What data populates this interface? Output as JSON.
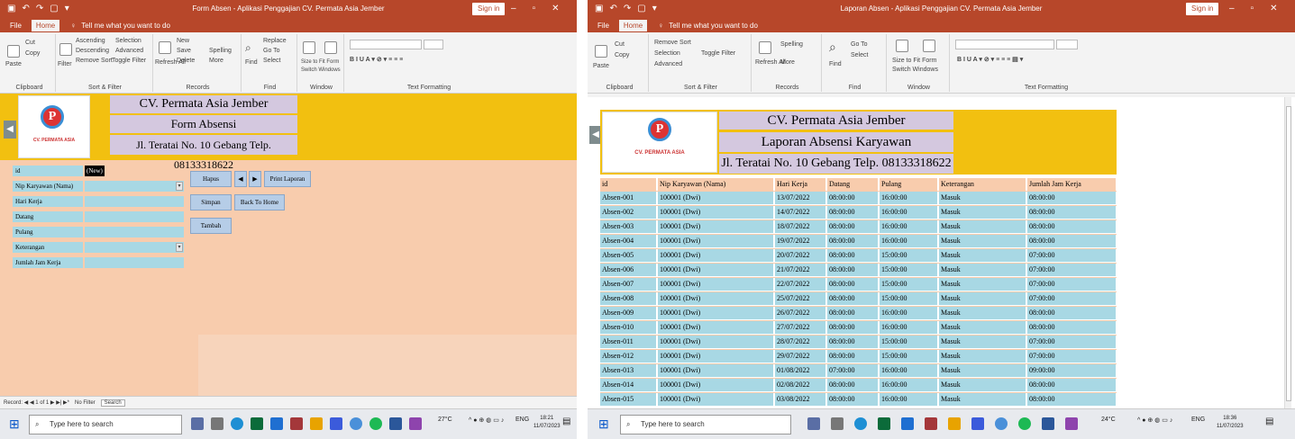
{
  "form_window": {
    "title": "Form Absen - Aplikasi Penggajian CV. Permata Asia Jember",
    "sign_in": "Sign in",
    "tabs": [
      "File",
      "Home"
    ],
    "tell_me": "Tell me what you want to do",
    "ribbon": {
      "clipboard": {
        "label": "Clipboard",
        "items": [
          "Cut",
          "Copy",
          "Paste"
        ]
      },
      "sort_filter": {
        "label": "Sort & Filter",
        "items": [
          "Ascending",
          "Descending",
          "Remove Sort",
          "Selection",
          "Advanced",
          "Toggle Filter",
          "Filter"
        ]
      },
      "records": {
        "label": "Records",
        "items": [
          "New",
          "Save",
          "Delete",
          "Refresh All",
          "Spelling",
          "More"
        ]
      },
      "find": {
        "label": "Find",
        "items": [
          "Replace",
          "Go To",
          "Select",
          "Find"
        ]
      },
      "window": {
        "label": "Window",
        "items": [
          "Size to Fit Form",
          "Switch Windows"
        ]
      },
      "text_formatting": {
        "label": "Text Formatting"
      }
    },
    "header": {
      "company": "CV. Permata Asia Jember",
      "subtitle": "Form Absensi",
      "address": "Jl. Teratai No. 10 Gebang Telp. 08133318622",
      "logo_text": "CV. PERMATA ASIA"
    },
    "fields": [
      {
        "label": "id",
        "value": "(New)"
      },
      {
        "label": "Nip Karyawan (Nama)",
        "value": ""
      },
      {
        "label": "Hari Kerja",
        "value": ""
      },
      {
        "label": "Datang",
        "value": ""
      },
      {
        "label": "Pulang",
        "value": ""
      },
      {
        "label": "Keterangan",
        "value": ""
      },
      {
        "label": "Jumlah Jam Kerja",
        "value": ""
      }
    ],
    "buttons": {
      "hapus": "Hapus",
      "prev": "◀",
      "next": "▶",
      "print": "Print Laporan",
      "simpan": "Simpan",
      "back": "Back To Home",
      "tambah": "Tambah"
    },
    "record_bar": {
      "record": "Record: ◀  ◀ 1 of 1  ▶  ▶|  ▶*",
      "filter": "No Filter",
      "search": "Search"
    },
    "taskbar": {
      "search_placeholder": "Type here to search",
      "weather": "27°C",
      "lang": "ENG",
      "time": "18:21",
      "date": "11/07/2023"
    }
  },
  "report_window": {
    "title": "Laporan Absen - Aplikasi Penggajian CV. Permata Asia Jember",
    "sign_in": "Sign in",
    "tabs": [
      "File",
      "Home"
    ],
    "tell_me": "Tell me what you want to do",
    "ribbon": {
      "clipboard": {
        "label": "Clipboard",
        "items": [
          "Cut",
          "Copy",
          "Paste"
        ]
      },
      "sort_filter": {
        "label": "Sort & Filter",
        "items": [
          "Remove Sort",
          "Selection",
          "Advanced",
          "Toggle Filter"
        ]
      },
      "records": {
        "label": "Records",
        "items": [
          "Spelling",
          "Refresh All",
          "More"
        ]
      },
      "find": {
        "label": "Find",
        "items": [
          "Go To",
          "Select",
          "Find"
        ]
      },
      "window": {
        "label": "Window",
        "items": [
          "Size to Fit Form",
          "Switch Windows"
        ]
      },
      "text_formatting": {
        "label": "Text Formatting"
      }
    },
    "header": {
      "company": "CV. Permata Asia Jember",
      "subtitle": "Laporan Absensi Karyawan",
      "address": "Jl. Teratai No. 10 Gebang Telp. 08133318622",
      "logo_text": "CV. PERMATA ASIA"
    },
    "table": {
      "columns": [
        "id",
        "Nip Karyawan (Nama)",
        "Hari Kerja",
        "Datang",
        "Pulang",
        "Keterangan",
        "Jumlah Jam Kerja"
      ],
      "rows": [
        [
          "Absen-001",
          "100001 (Dwi)",
          "13/07/2022",
          "08:00:00",
          "16:00:00",
          "Masuk",
          "08:00:00"
        ],
        [
          "Absen-002",
          "100001 (Dwi)",
          "14/07/2022",
          "08:00:00",
          "16:00:00",
          "Masuk",
          "08:00:00"
        ],
        [
          "Absen-003",
          "100001 (Dwi)",
          "18/07/2022",
          "08:00:00",
          "16:00:00",
          "Masuk",
          "08:00:00"
        ],
        [
          "Absen-004",
          "100001 (Dwi)",
          "19/07/2022",
          "08:00:00",
          "16:00:00",
          "Masuk",
          "08:00:00"
        ],
        [
          "Absen-005",
          "100001 (Dwi)",
          "20/07/2022",
          "08:00:00",
          "15:00:00",
          "Masuk",
          "07:00:00"
        ],
        [
          "Absen-006",
          "100001 (Dwi)",
          "21/07/2022",
          "08:00:00",
          "15:00:00",
          "Masuk",
          "07:00:00"
        ],
        [
          "Absen-007",
          "100001 (Dwi)",
          "22/07/2022",
          "08:00:00",
          "15:00:00",
          "Masuk",
          "07:00:00"
        ],
        [
          "Absen-008",
          "100001 (Dwi)",
          "25/07/2022",
          "08:00:00",
          "15:00:00",
          "Masuk",
          "07:00:00"
        ],
        [
          "Absen-009",
          "100001 (Dwi)",
          "26/07/2022",
          "08:00:00",
          "16:00:00",
          "Masuk",
          "08:00:00"
        ],
        [
          "Absen-010",
          "100001 (Dwi)",
          "27/07/2022",
          "08:00:00",
          "16:00:00",
          "Masuk",
          "08:00:00"
        ],
        [
          "Absen-011",
          "100001 (Dwi)",
          "28/07/2022",
          "08:00:00",
          "15:00:00",
          "Masuk",
          "07:00:00"
        ],
        [
          "Absen-012",
          "100001 (Dwi)",
          "29/07/2022",
          "08:00:00",
          "15:00:00",
          "Masuk",
          "07:00:00"
        ],
        [
          "Absen-013",
          "100001 (Dwi)",
          "01/08/2022",
          "07:00:00",
          "16:00:00",
          "Masuk",
          "09:00:00"
        ],
        [
          "Absen-014",
          "100001 (Dwi)",
          "02/08/2022",
          "08:00:00",
          "16:00:00",
          "Masuk",
          "08:00:00"
        ],
        [
          "Absen-015",
          "100001 (Dwi)",
          "03/08/2022",
          "08:00:00",
          "16:00:00",
          "Masuk",
          "08:00:00"
        ]
      ]
    },
    "taskbar": {
      "search_placeholder": "Type here to search",
      "weather": "24°C",
      "lang": "ENG",
      "time": "18:36",
      "date": "11/07/2023"
    }
  },
  "colors": {
    "access_red": "#b7472a",
    "banner_yellow": "#f2c010",
    "form_peach": "#f8ccad",
    "field_blue": "#a8d8e4",
    "header_lavender": "#d4c8df",
    "button_blue": "#b6cde7"
  }
}
